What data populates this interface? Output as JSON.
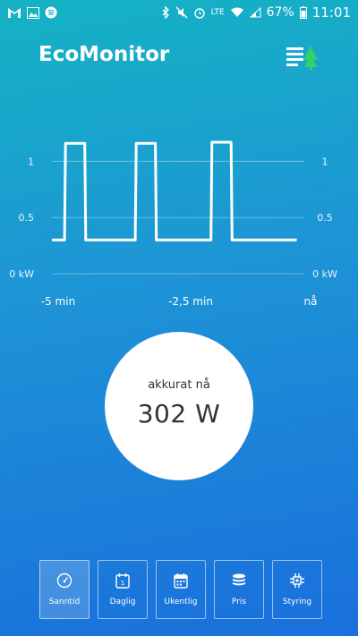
{
  "status_bar": {
    "battery": "67%",
    "time": "11:01",
    "network_label": "LTE"
  },
  "header": {
    "title": "EcoMonitor"
  },
  "chart_data": {
    "type": "line",
    "x_tick_labels": [
      "-5 min",
      "-2,5 min",
      "nå"
    ],
    "y_tick_labels_left": [
      "1",
      "0.5",
      "0 kW"
    ],
    "y_tick_labels_right": [
      "1",
      "0.5",
      "0 kW"
    ],
    "ylim": [
      0,
      1.2
    ],
    "xlim": [
      -5,
      0
    ],
    "x": [
      -5.0,
      -4.75,
      -4.73,
      -4.35,
      -4.33,
      -3.35,
      -3.33,
      -2.95,
      -2.93,
      -1.85,
      -1.83,
      -1.45,
      -1.43,
      -0.15
    ],
    "y": [
      0.3,
      0.3,
      1.16,
      1.16,
      0.3,
      0.3,
      1.16,
      1.16,
      0.3,
      0.3,
      1.17,
      1.17,
      0.3,
      0.3
    ],
    "grid": true
  },
  "reading": {
    "label": "akkurat nå",
    "value": "302 W"
  },
  "nav": {
    "items": [
      {
        "label": "Sanntid"
      },
      {
        "label": "Daglig"
      },
      {
        "label": "Ukentlig"
      },
      {
        "label": "Pris"
      },
      {
        "label": "Styring"
      }
    ]
  }
}
